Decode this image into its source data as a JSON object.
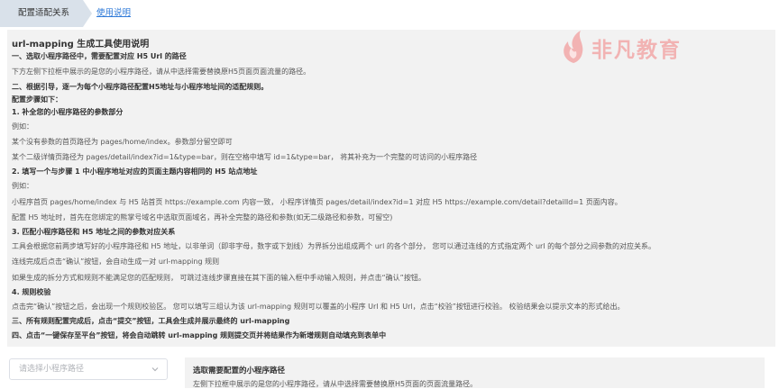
{
  "tabs": {
    "active": "配置适配关系",
    "help": "使用说明"
  },
  "watermark": {
    "text": "非凡教育"
  },
  "guide": {
    "lines": [
      "url-mapping 生成工具使用说明",
      "一、选取小程序路径中，需要配置对应 H5 Url 的路径",
      "下方左侧下拉框中展示的是您的小程序路径，请从中选择需要替换原H5页面页面流量的路径。",
      "二、根据引导，逐一为每个小程序路径配置H5地址与小程序地址间的适配规则。",
      "配置步骤如下：",
      "1. 补全您的小程序路径的参数部分",
      "例如：",
      "某个没有参数的首页路径为 pages/home/index。参数部分留空即可",
      "某个二级详情页路径为 pages/detail/index?id=1&type=bar，则在空格中填写 id=1&type=bar，  将其补充为一个完整的可访问的小程序路径",
      "2. 填写一个与步骤 1 中小程序地址对应的页面主题内容相同的 H5 站点地址",
      "例如：",
      "小程序首页 pages/home/index 与 H5 站首页 https://example.com 内容一致，  小程序详情页 pages/detail/index?id=1 对应 H5 https://example.com/detail?detailId=1 页面内容。",
      "配置 H5 地址时，首先在您绑定的熊掌号域名中选取页面域名，再补全完整的路径和参数(如无二级路径和参数，可留空)",
      "3. 匹配小程序路径和 H5 地址之间的参数对应关系",
      "工具会根据您前两步填写好的小程序路径和 H5 地址，以非单词（即非字母，数字或下划线）为界拆分出组成两个 url 的各个部分，  您可以通过连线的方式指定两个 url 的每个部分之间参数的对应关系。",
      "连线完成后点击“确认”按钮，会自动生成一对 url-mapping 规则",
      "如果生成的拆分方式和规则不能满足您的匹配规则，  可跳过连线步骤直接在其下面的输入框中手动输入规则，并点击“确认”按钮。",
      "4. 规则校验",
      "点击完“确认”按钮之后，会出现一个规则校验区。  您可以填写三组认为该 url-mapping 规则可以覆盖的小程序 Url 和 H5 Url，点击“校验”按钮进行校验。  校验结果会以提示文本的形式给出。",
      "三、所有规则配置完成后，点击“提交”按钮，工具会生成并展示最终的 url-mapping",
      "四、点击“一键保存至平台”按钮，将会自动跳转 url-mapping 规则提交页并将结果作为新增规则自动填充到表单中"
    ]
  },
  "selector": {
    "placeholder": "请选择小程序路径"
  },
  "panel": {
    "title": "选取需要配置的小程序路径",
    "desc": "左侧下拉框中展示的是您的小程序路径，请从中选择需要替换原H5页面的页面流量路径。"
  }
}
